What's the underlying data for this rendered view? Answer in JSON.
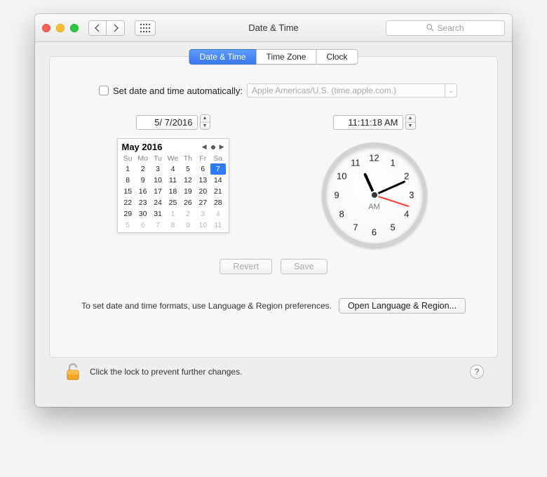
{
  "window": {
    "title": "Date & Time"
  },
  "toolbar": {
    "search_placeholder": "Search"
  },
  "tabs": {
    "date_time": "Date & Time",
    "time_zone": "Time Zone",
    "clock": "Clock"
  },
  "auto": {
    "label": "Set date and time automatically:",
    "server": "Apple Americas/U.S. (time.apple.com.)",
    "checked": false
  },
  "date": {
    "value": "5/ 7/2016",
    "month_label": "May 2016",
    "dow": [
      "Su",
      "Mo",
      "Tu",
      "We",
      "Th",
      "Fr",
      "Sa"
    ],
    "weeks": [
      [
        {
          "d": 1
        },
        {
          "d": 2
        },
        {
          "d": 3
        },
        {
          "d": 4
        },
        {
          "d": 5
        },
        {
          "d": 6
        },
        {
          "d": 7,
          "sel": true
        }
      ],
      [
        {
          "d": 8
        },
        {
          "d": 9
        },
        {
          "d": 10
        },
        {
          "d": 11
        },
        {
          "d": 12
        },
        {
          "d": 13
        },
        {
          "d": 14
        }
      ],
      [
        {
          "d": 15
        },
        {
          "d": 16
        },
        {
          "d": 17
        },
        {
          "d": 18
        },
        {
          "d": 19
        },
        {
          "d": 20
        },
        {
          "d": 21
        }
      ],
      [
        {
          "d": 22
        },
        {
          "d": 23
        },
        {
          "d": 24
        },
        {
          "d": 25
        },
        {
          "d": 26
        },
        {
          "d": 27
        },
        {
          "d": 28
        }
      ],
      [
        {
          "d": 29
        },
        {
          "d": 30
        },
        {
          "d": 31
        },
        {
          "d": 1,
          "off": true
        },
        {
          "d": 2,
          "off": true
        },
        {
          "d": 3,
          "off": true
        },
        {
          "d": 4,
          "off": true
        }
      ],
      [
        {
          "d": 5,
          "off": true
        },
        {
          "d": 6,
          "off": true
        },
        {
          "d": 7,
          "off": true
        },
        {
          "d": 8,
          "off": true
        },
        {
          "d": 9,
          "off": true
        },
        {
          "d": 10,
          "off": true
        },
        {
          "d": 11,
          "off": true
        }
      ]
    ]
  },
  "time": {
    "value": "11:11:18 AM",
    "ampm": "AM",
    "hour": 11,
    "minute": 11,
    "second": 18
  },
  "buttons": {
    "revert": "Revert",
    "save": "Save",
    "open_lang": "Open Language & Region..."
  },
  "hint": "To set date and time formats, use Language & Region preferences.",
  "footer": {
    "lock_text": "Click the lock to prevent further changes."
  }
}
